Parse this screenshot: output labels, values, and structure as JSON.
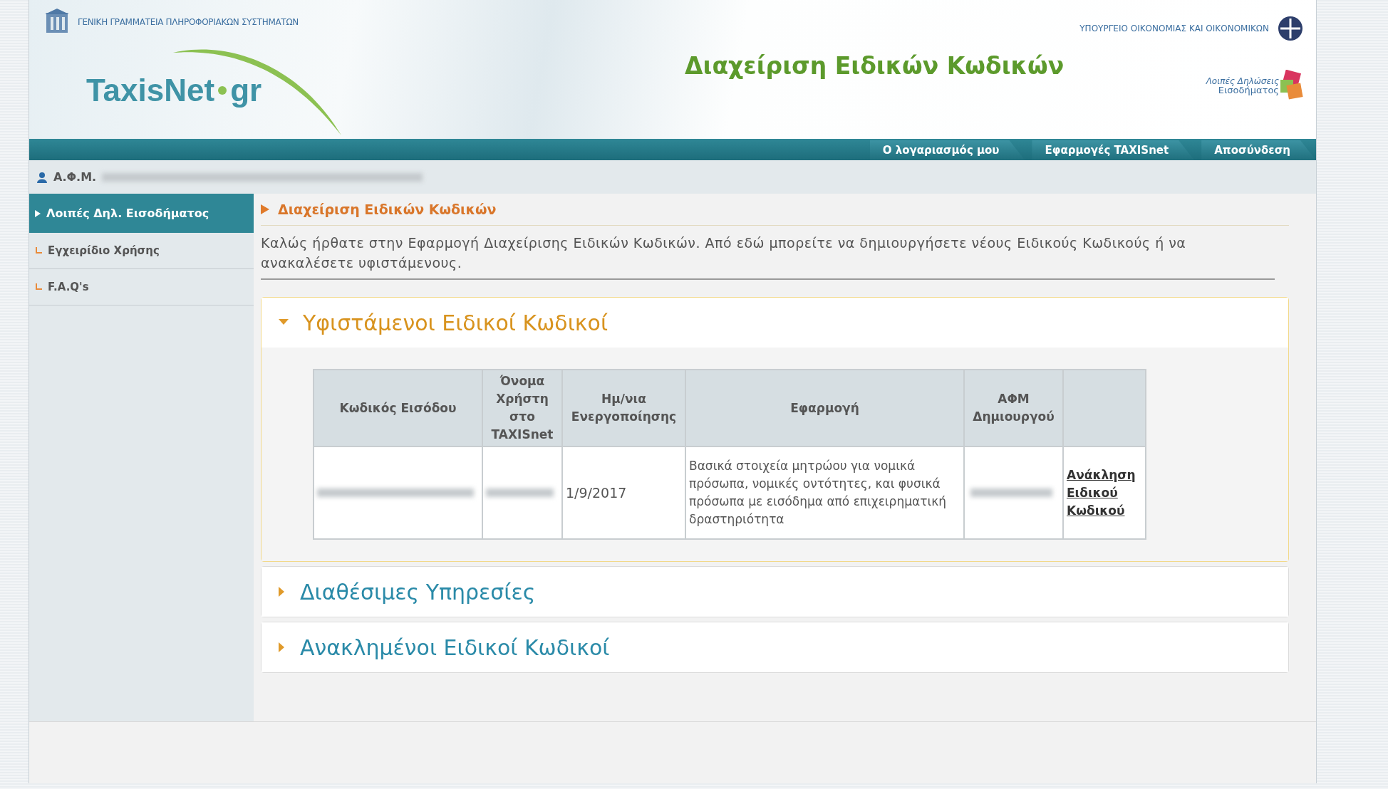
{
  "header": {
    "agency": "ΓΕΝΙΚΗ ΓΡΑΜΜΑΤΕΙΑ ΠΛΗΡΟΦΟΡΙΑΚΩΝ ΣΥΣΤΗΜΑΤΩΝ",
    "logo_left": "TaxisNet",
    "logo_right": "gr",
    "ministry": "ΥΠΟΥΡΓΕΙΟ ΟΙΚΟΝΟΜΙΑΣ ΚΑΙ ΟΙΚΟΝΟΜΙΚΩΝ",
    "title": "Διαχείριση Ειδικών Κωδικών",
    "badge_line1": "Λοιπές Δηλώσεις",
    "badge_line2": "Εισοδήματος"
  },
  "nav": [
    {
      "label": "Ο λογαριασμός μου"
    },
    {
      "label": "Εφαρμογές TAXISnet"
    },
    {
      "label": "Αποσύνδεση"
    }
  ],
  "user_label": "Α.Φ.Μ.",
  "sidebar": {
    "items": [
      {
        "label": "Λοιπές Δηλ. Εισοδήματος",
        "selected": true
      },
      {
        "label": "Εγχειρίδιο Χρήσης",
        "selected": false
      },
      {
        "label": "F.A.Q's",
        "selected": false
      }
    ]
  },
  "breadcrumb": "Διαχείριση Ειδικών Κωδικών",
  "intro": "Καλώς ήρθατε στην Εφαρμογή Διαχείρισης Ειδικών Κωδικών. Από εδώ μπορείτε να δημιουργήσετε νέους Ειδικούς Κωδικούς ή να ανακαλέσετε υφιστάμενους.",
  "sections": [
    {
      "title": "Υφιστάμενοι Ειδικοί Κωδικοί",
      "expanded": true,
      "table": {
        "columns": [
          "Κωδικός Εισόδου",
          "Όνομα Χρήστη στο TAXISnet",
          "Ημ/νια Ενεργοποίησης",
          "Εφαρμογή",
          "ΑΦΜ Δημιουργού"
        ],
        "rows": [
          {
            "date": "1/9/2017",
            "application": "Βασικά στοιχεία μητρώου για νομικά πρόσωπα, νομικές οντότητες, και φυσικά πρόσωπα με εισόδημα από επιχειρηματική δραστηριότητα",
            "action": "Ανάκληση Ειδικού Κωδικού"
          }
        ]
      }
    },
    {
      "title": "Διαθέσιμες Υπηρεσίες",
      "expanded": false
    },
    {
      "title": "Ανακλημένοι Ειδικοί Κωδικοί",
      "expanded": false
    }
  ]
}
